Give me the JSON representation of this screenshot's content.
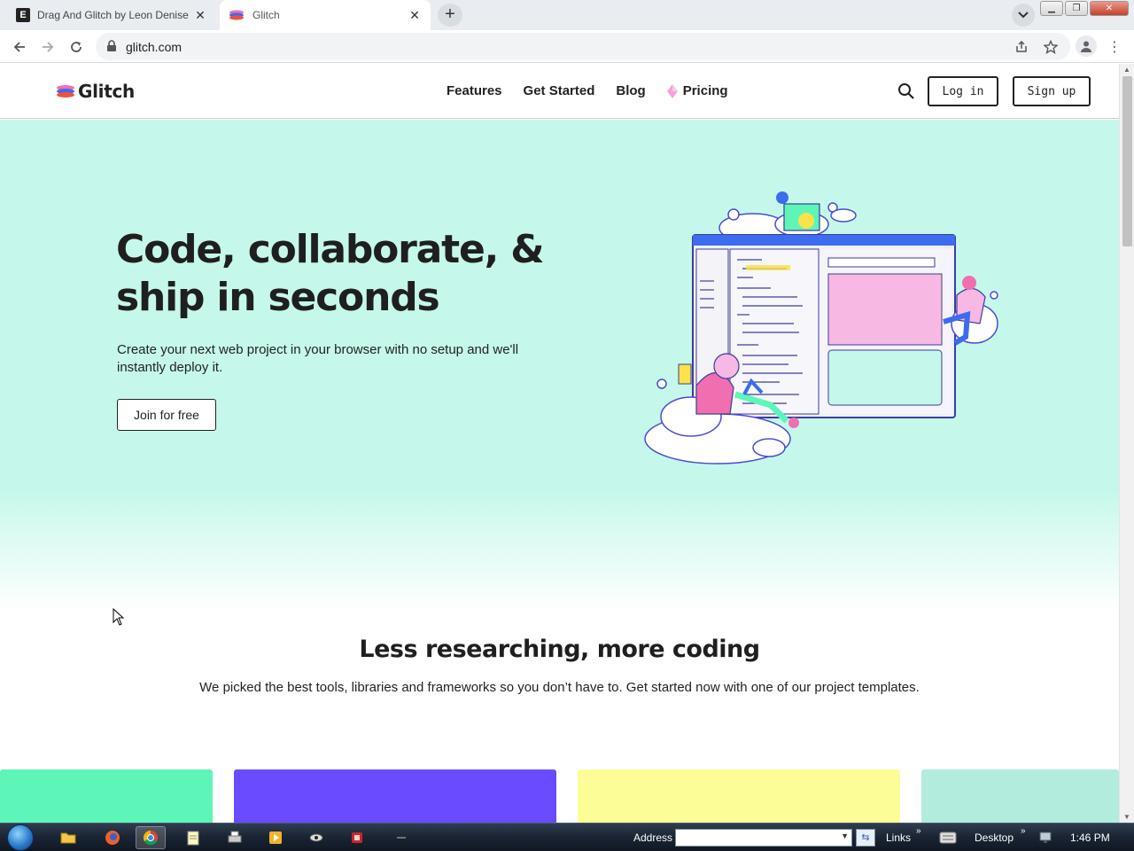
{
  "browser": {
    "tabs": [
      {
        "title": "Drag And Glitch by Leon Denise",
        "favicon": "E",
        "active": false
      },
      {
        "title": "Glitch",
        "active": true
      }
    ],
    "url": "glitch.com"
  },
  "site": {
    "logo_text": "Glitch",
    "nav": [
      "Features",
      "Get Started",
      "Blog",
      "Pricing"
    ],
    "login_label": "Log in",
    "signup_label": "Sign up"
  },
  "hero": {
    "title_line1": "Code, collaborate, &",
    "title_line2": "ship in seconds",
    "subtitle": "Create your next web project in your browser with no setup and we'll instantly deploy it.",
    "cta_label": "Join for free"
  },
  "section2": {
    "title": "Less researching, more coding",
    "subtitle": "We picked the best tools, libraries and frameworks so you don’t have to. Get started now with one of our project templates."
  },
  "cards": {
    "colors": [
      "#5ef5b9",
      "#6b4bff",
      "#fdfd98",
      "#b1ecdc"
    ]
  },
  "taskbar": {
    "address_label": "Address",
    "links_label": "Links",
    "desktop_label": "Desktop",
    "clock": "1:46 PM"
  },
  "colors": {
    "hero_bg": "#c5f8ea",
    "accent_pink": "#f5a3d8",
    "accent_blue": "#3d6cf0"
  }
}
